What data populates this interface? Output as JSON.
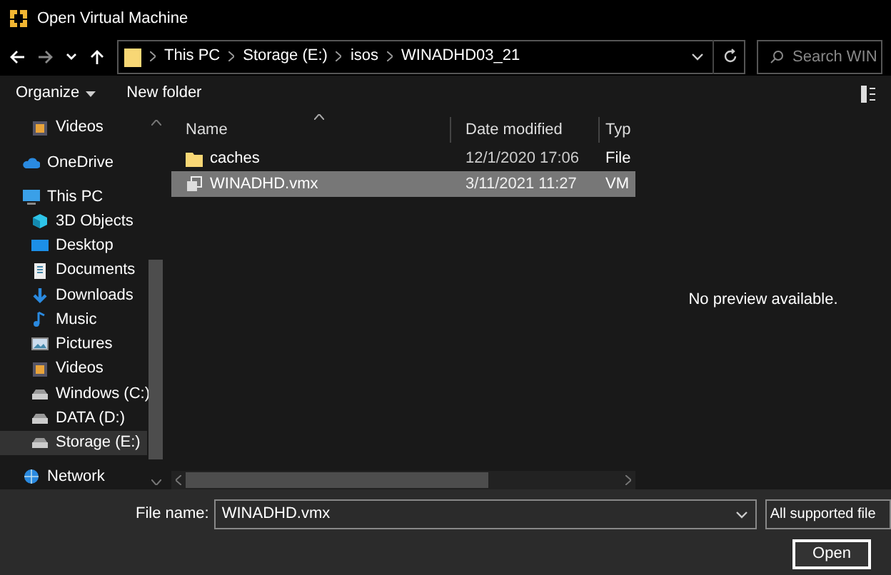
{
  "window": {
    "title": "Open Virtual Machine"
  },
  "address_bar": {
    "segments": [
      "This PC",
      "Storage (E:)",
      "isos",
      "WINADHD03_21"
    ]
  },
  "search": {
    "placeholder": "Search WIN"
  },
  "toolbar": {
    "organize": "Organize",
    "new_folder": "New folder"
  },
  "sidebar": {
    "quick_access_items": [
      {
        "label": "Videos",
        "kind": "videos",
        "selected": false
      }
    ],
    "items": [
      {
        "label": "OneDrive",
        "kind": "cloud",
        "selected": false
      },
      {
        "label": "This PC",
        "kind": "pc",
        "selected": false,
        "children": [
          {
            "label": "3D Objects",
            "kind": "cube",
            "selected": false
          },
          {
            "label": "Desktop",
            "kind": "desktop",
            "selected": false
          },
          {
            "label": "Documents",
            "kind": "document",
            "selected": false
          },
          {
            "label": "Downloads",
            "kind": "download",
            "selected": false
          },
          {
            "label": "Music",
            "kind": "music",
            "selected": false
          },
          {
            "label": "Pictures",
            "kind": "pictures",
            "selected": false
          },
          {
            "label": "Videos",
            "kind": "videos",
            "selected": false
          },
          {
            "label": "Windows (C:)",
            "kind": "drive",
            "selected": false
          },
          {
            "label": "DATA (D:)",
            "kind": "drive",
            "selected": false
          },
          {
            "label": "Storage (E:)",
            "kind": "drive",
            "selected": true
          }
        ]
      },
      {
        "label": "Network",
        "kind": "network",
        "selected": false
      }
    ]
  },
  "table": {
    "columns": [
      "Name",
      "Date modified",
      "Typ"
    ],
    "rows": [
      {
        "kind": "folder",
        "name": "caches",
        "date": "12/1/2020 17:06",
        "type": "File",
        "selected": false
      },
      {
        "kind": "vmx",
        "name": "WINADHD.vmx",
        "date": "3/11/2021 11:27",
        "type": "VM",
        "selected": true
      }
    ]
  },
  "preview": {
    "message": "No preview available."
  },
  "footer": {
    "file_name_label": "File name:",
    "file_name": "WINADHD.vmx",
    "filter": "All supported file",
    "open_button": "Open"
  }
}
